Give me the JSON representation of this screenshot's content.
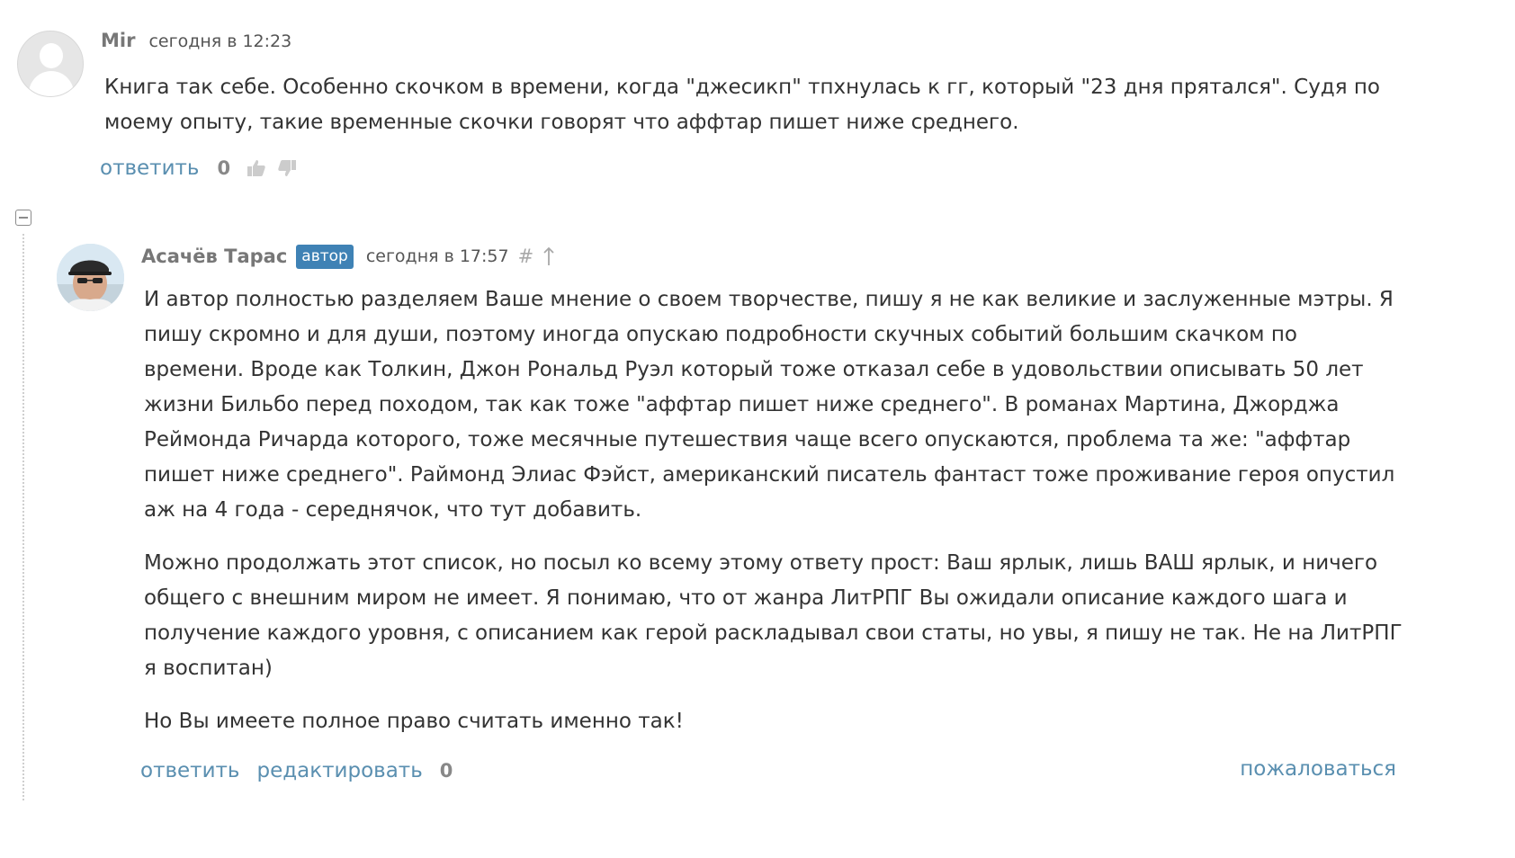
{
  "comment1": {
    "author": "Mir",
    "date": "сегодня в 12:23",
    "text": "Книга так себе. Особенно скочком в времени, когда \"джесикп\" тпхнулась к гг, который \"23 дня прятался\". Судя по моему опыту, такие временные скочки говорят что аффтар пишет ниже среднего.",
    "reply_label": "ответить",
    "score": "0",
    "icons": {
      "avatar": "default-user-avatar-icon",
      "like": "thumbs-up-icon",
      "dislike": "thumbs-down-icon"
    }
  },
  "thread": {
    "collapse_icon": "collapse-minus-icon"
  },
  "comment2": {
    "author": "Асачёв Тарас",
    "badge": "автор",
    "date": "сегодня в 17:57",
    "hash": "#",
    "paragraphs": [
      "И автор полностью разделяем Ваше мнение о своем творчестве, пишу я не как великие и заслуженные мэтры. Я пишу скромно и для души, поэтому иногда опускаю подробности скучных событий большим скачком по времени. Вроде как Толкин, Джон Рональд Руэл который тоже отказал себе в удовольствии описывать 50 лет жизни Бильбо перед походом, так как тоже \"аффтар пишет ниже среднего\". В романах Мартина, Джорджа Реймонда Ричарда которого, тоже месячные путешествия чаще всего опускаются, проблема та же: \"аффтар пишет ниже среднего\". Раймонд Элиас Фэйст, американский писатель фантаст тоже проживание героя опустил аж на 4 года - середнячок, что тут добавить.",
      "Можно продолжать этот список, но посыл ко всему этому ответу прост: Ваш ярлык, лишь ВАШ ярлык, и ничего общего с внешним миром не имеет. Я понимаю, что от жанра ЛитРПГ Вы ожидали описание каждого шага и получение каждого уровня, с описанием как герой раскладывал свои статы, но увы, я пишу не так. Не на ЛитРПГ я воспитан)",
      "Но Вы имеете полное право считать именно так!"
    ],
    "reply_label": "ответить",
    "edit_label": "редактировать",
    "score": "0",
    "report_label": "пожаловаться",
    "icons": {
      "avatar": "user-photo-avatar-icon",
      "parent": "arrow-up-icon"
    }
  },
  "colors": {
    "link": "#5a8fb0",
    "badge": "#3f82b5",
    "muted": "#888888",
    "text": "#333333"
  }
}
